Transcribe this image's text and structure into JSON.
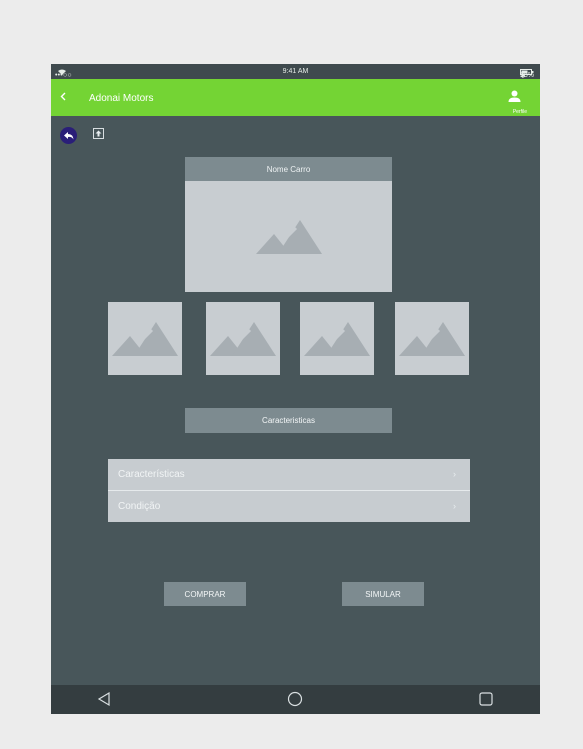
{
  "status_bar": {
    "carrier": "•••○○ GS",
    "wifi_icon": "wifi-icon",
    "time": "9:41 AM",
    "battery": "58%"
  },
  "app_bar": {
    "back_icon": "chevron-left-icon",
    "title": "Adonai Motors",
    "profile_label": "Perfile",
    "accent_color": "#74d434"
  },
  "toolbar": {
    "undo_icon": "undo-icon",
    "upload_icon": "upload-icon"
  },
  "car": {
    "name_label": "Nome Carro",
    "main_image_icon": "image-placeholder-icon",
    "thumbnail_count": 4
  },
  "features_button": "Caracteristicas",
  "list": [
    {
      "label": "Características",
      "chevron": "›"
    },
    {
      "label": "Condição",
      "chevron": "›"
    }
  ],
  "actions": {
    "buy_label": "COMPRAR",
    "simulate_label": "SIMULAR"
  },
  "nav_bar": {
    "back_icon": "triangle-back-icon",
    "home_icon": "circle-home-icon",
    "recent_icon": "square-recent-icon"
  }
}
